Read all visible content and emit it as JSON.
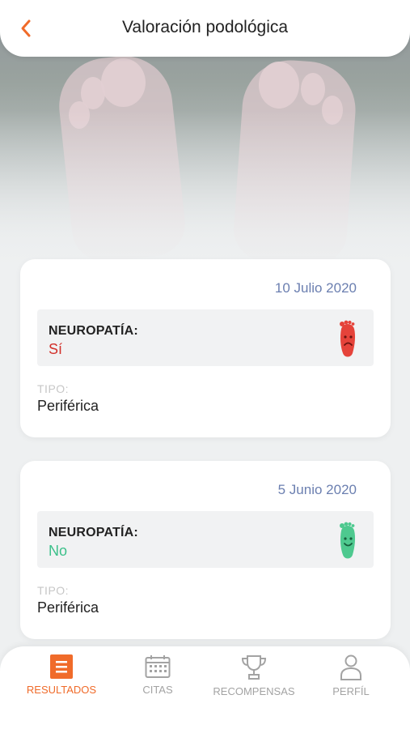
{
  "header": {
    "title": "Valoración podológica",
    "back_icon": "chevron-left-icon"
  },
  "records": [
    {
      "date": "10 Julio 2020",
      "neuropathy_label": "NEUROPATÍA:",
      "neuropathy_value": "Sí",
      "value_color": "#d2302a",
      "icon": "sad-foot-icon",
      "icon_color": "#e5433a",
      "type_label": "TIPO:",
      "type_value": "Periférica"
    },
    {
      "date": "5 Junio 2020",
      "neuropathy_label": "NEUROPATÍA:",
      "neuropathy_value": "No",
      "value_color": "#3cc08a",
      "icon": "happy-foot-icon",
      "icon_color": "#4ec98f",
      "type_label": "TIPO:",
      "type_value": "Periférica"
    }
  ],
  "nav": {
    "items": [
      {
        "label": "RESULTADOS",
        "icon": "list-icon",
        "active": true
      },
      {
        "label": "CITAS",
        "icon": "calendar-icon",
        "active": false
      },
      {
        "label": "RECOMPENSAS",
        "icon": "trophy-icon",
        "active": false
      },
      {
        "label": "PERFÍL",
        "icon": "user-icon",
        "active": false
      }
    ]
  },
  "colors": {
    "accent": "#f06b2a",
    "date": "#6b7fb0"
  }
}
